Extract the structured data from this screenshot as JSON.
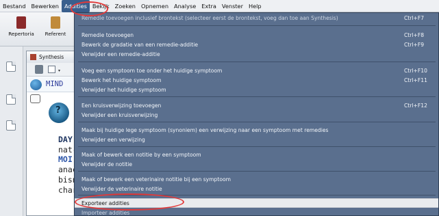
{
  "menubar": {
    "items": [
      "Bestand",
      "Bewerken",
      "Addities",
      "Bekijk",
      "Zoeken",
      "Opnemen",
      "Analyse",
      "Extra",
      "Venster",
      "Help"
    ],
    "active_index": 2
  },
  "toolbar": {
    "buttons": [
      {
        "label": "Repertoria",
        "icon": "repertory-book-icon",
        "color": "#8b2a2a"
      },
      {
        "label": "Referent",
        "icon": "reference-book-icon",
        "color": "#c08a3a"
      }
    ]
  },
  "document": {
    "tab_label": "Synthesis",
    "mind_label": "MIND",
    "content_lines": [
      {
        "text": "DAY",
        "style": "bold"
      },
      {
        "text": "nat-",
        "style": "normal"
      },
      {
        "text": "MOI",
        "style": "blue"
      },
      {
        "text": "anac",
        "style": "normal"
      },
      {
        "text": "bisn",
        "style": "normal"
      },
      {
        "text": "char",
        "style": "normal"
      }
    ],
    "head_icon_char": "?"
  },
  "dropdown": {
    "items": [
      {
        "label": "Remedie toevoegen inclusief brontekst (selecteer eerst de brontekst, voeg dan toe aan Synthesis)",
        "shortcut": "Ctrl+F7"
      },
      {
        "label": "Remedie toevoegen",
        "shortcut": "Ctrl+F8"
      },
      {
        "label": "Bewerk de gradatie van een remedie-additie",
        "shortcut": "Ctrl+F9"
      },
      {
        "label": "Verwijder een remedie-additie",
        "shortcut": ""
      },
      {
        "label": "Voeg een symptoom toe onder het huidige symptoom",
        "shortcut": "Ctrl+F10"
      },
      {
        "label": "Bewerk het huidige symptoom",
        "shortcut": "Ctrl+F11"
      },
      {
        "label": "Verwijder het huidige symptoom",
        "shortcut": ""
      },
      {
        "label": "Een kruisverwijzing toevoegen",
        "shortcut": "Ctrl+F12"
      },
      {
        "label": "Verwijder een kruisverwijzing",
        "shortcut": ""
      },
      {
        "label": "Maak bij huidige lege symptoom (synoniem) een verwijzing naar een symptoom met remedies",
        "shortcut": ""
      },
      {
        "label": "Verwijder een verwijzing",
        "shortcut": ""
      },
      {
        "label": "Maak of bewerk een notitie by een symptoom",
        "shortcut": ""
      },
      {
        "label": "Verwijder de notitie",
        "shortcut": ""
      },
      {
        "label": "Maak of bewerk een veterinaire notitie bij een symptoom",
        "shortcut": ""
      },
      {
        "label": "Verwijder de veterinaire notitie",
        "shortcut": ""
      },
      {
        "label": "Exporteer addities",
        "shortcut": ""
      },
      {
        "label": "Importeer addities",
        "shortcut": ""
      }
    ],
    "highlighted_index": 15
  },
  "colors": {
    "menu_bg": "#5a6f8e",
    "highlight_bg": "#e9ebee",
    "annotation": "#e23a3a"
  }
}
